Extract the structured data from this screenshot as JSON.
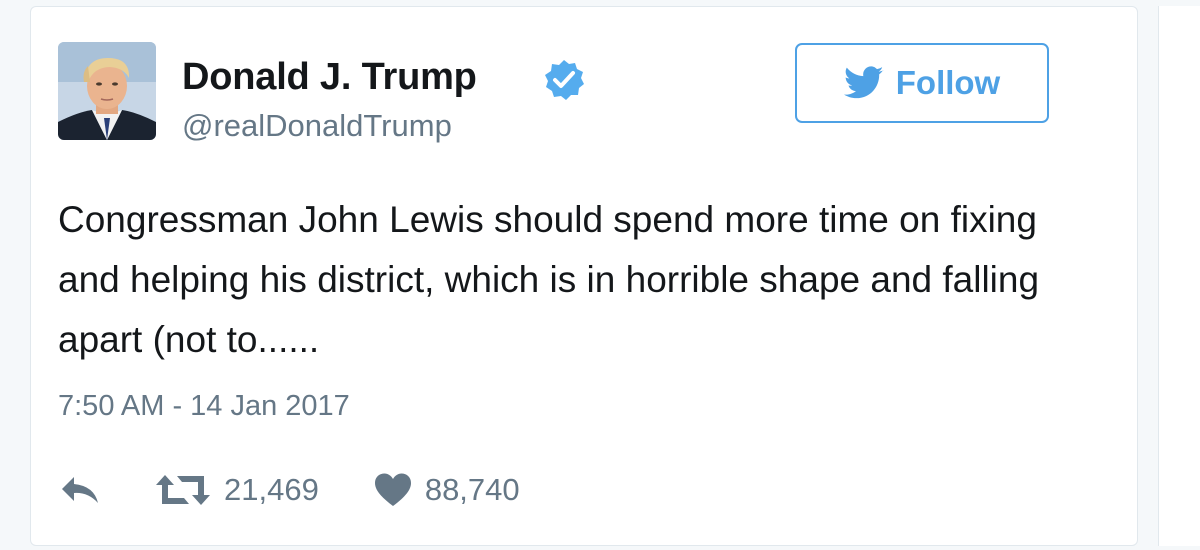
{
  "user": {
    "name": "Donald J. Trump",
    "handle": "@realDonaldTrump",
    "verified": true
  },
  "follow_button": {
    "label": "Follow",
    "icon": "twitter-bird-icon"
  },
  "tweet": {
    "text": "Congressman John Lewis should spend more time on fixing and helping his district, which is in horrible shape and falling apart (not to......",
    "timestamp": "7:50 AM - 14 Jan 2017"
  },
  "actions": {
    "reply_icon": "reply-icon",
    "retweet_icon": "retweet-icon",
    "retweet_count": "21,469",
    "like_icon": "heart-icon",
    "like_count": "88,740"
  },
  "colors": {
    "accent": "#4ea1e5",
    "text": "#14171a",
    "muted": "#657786",
    "action_icon": "#657786",
    "border": "#e1e8ed"
  }
}
